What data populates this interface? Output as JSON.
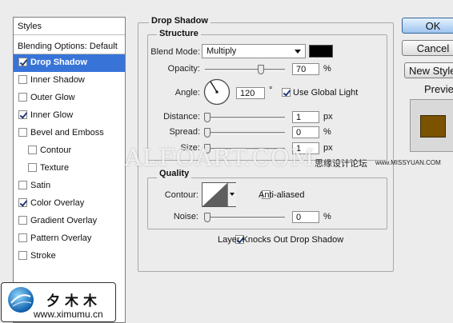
{
  "styles_panel": {
    "header": "Styles",
    "blending_options": "Blending Options: Default",
    "items": [
      {
        "label": "Drop Shadow",
        "checked": true,
        "selected": true,
        "indent": false
      },
      {
        "label": "Inner Shadow",
        "checked": false,
        "selected": false,
        "indent": false
      },
      {
        "label": "Outer Glow",
        "checked": false,
        "selected": false,
        "indent": false
      },
      {
        "label": "Inner Glow",
        "checked": true,
        "selected": false,
        "indent": false
      },
      {
        "label": "Bevel and Emboss",
        "checked": false,
        "selected": false,
        "indent": false
      },
      {
        "label": "Contour",
        "checked": false,
        "selected": false,
        "indent": true
      },
      {
        "label": "Texture",
        "checked": false,
        "selected": false,
        "indent": true
      },
      {
        "label": "Satin",
        "checked": false,
        "selected": false,
        "indent": false
      },
      {
        "label": "Color Overlay",
        "checked": true,
        "selected": false,
        "indent": false
      },
      {
        "label": "Gradient Overlay",
        "checked": false,
        "selected": false,
        "indent": false
      },
      {
        "label": "Pattern Overlay",
        "checked": false,
        "selected": false,
        "indent": false
      },
      {
        "label": "Stroke",
        "checked": false,
        "selected": false,
        "indent": false
      }
    ],
    "selected_color": "#3874d8"
  },
  "drop_shadow": {
    "title": "Drop Shadow",
    "structure": {
      "title": "Structure",
      "blend_mode_label": "Blend Mode:",
      "blend_mode_value": "Multiply",
      "shadow_color": "#000000",
      "opacity_label": "Opacity:",
      "opacity_value": "70",
      "opacity_unit": "%",
      "opacity_level": 0.7,
      "angle_label": "Angle:",
      "angle_value": "120",
      "angle_unit": "°",
      "use_global_light_label": "Use Global Light",
      "use_global_light_checked": true,
      "distance_label": "Distance:",
      "distance_value": "1",
      "distance_unit": "px",
      "spread_label": "Spread:",
      "spread_value": "0",
      "spread_unit": "%",
      "size_label": "Size:",
      "size_value": "1",
      "size_unit": "px"
    },
    "quality": {
      "title": "Quality",
      "contour_label": "Contour:",
      "anti_aliased_label": "Anti-aliased",
      "anti_aliased_checked": false,
      "noise_label": "Noise:",
      "noise_value": "0",
      "noise_unit": "%"
    },
    "layer_knocks_out_label": "Layer Knocks Out Drop Shadow",
    "layer_knocks_out_checked": true
  },
  "buttons": {
    "ok": "OK",
    "cancel": "Cancel",
    "new_style": "New Style...",
    "preview_label": "Preview",
    "preview_checked": true,
    "preview_swatch_color": "#7a5200"
  },
  "watermarks": {
    "main": "ALFOART.COM",
    "chinese_site": "思缘设计论坛",
    "missyuan": "www.MISSYUAN.COM",
    "logo_chinese": "夕木木",
    "logo_url": "www.ximumu.cn"
  }
}
